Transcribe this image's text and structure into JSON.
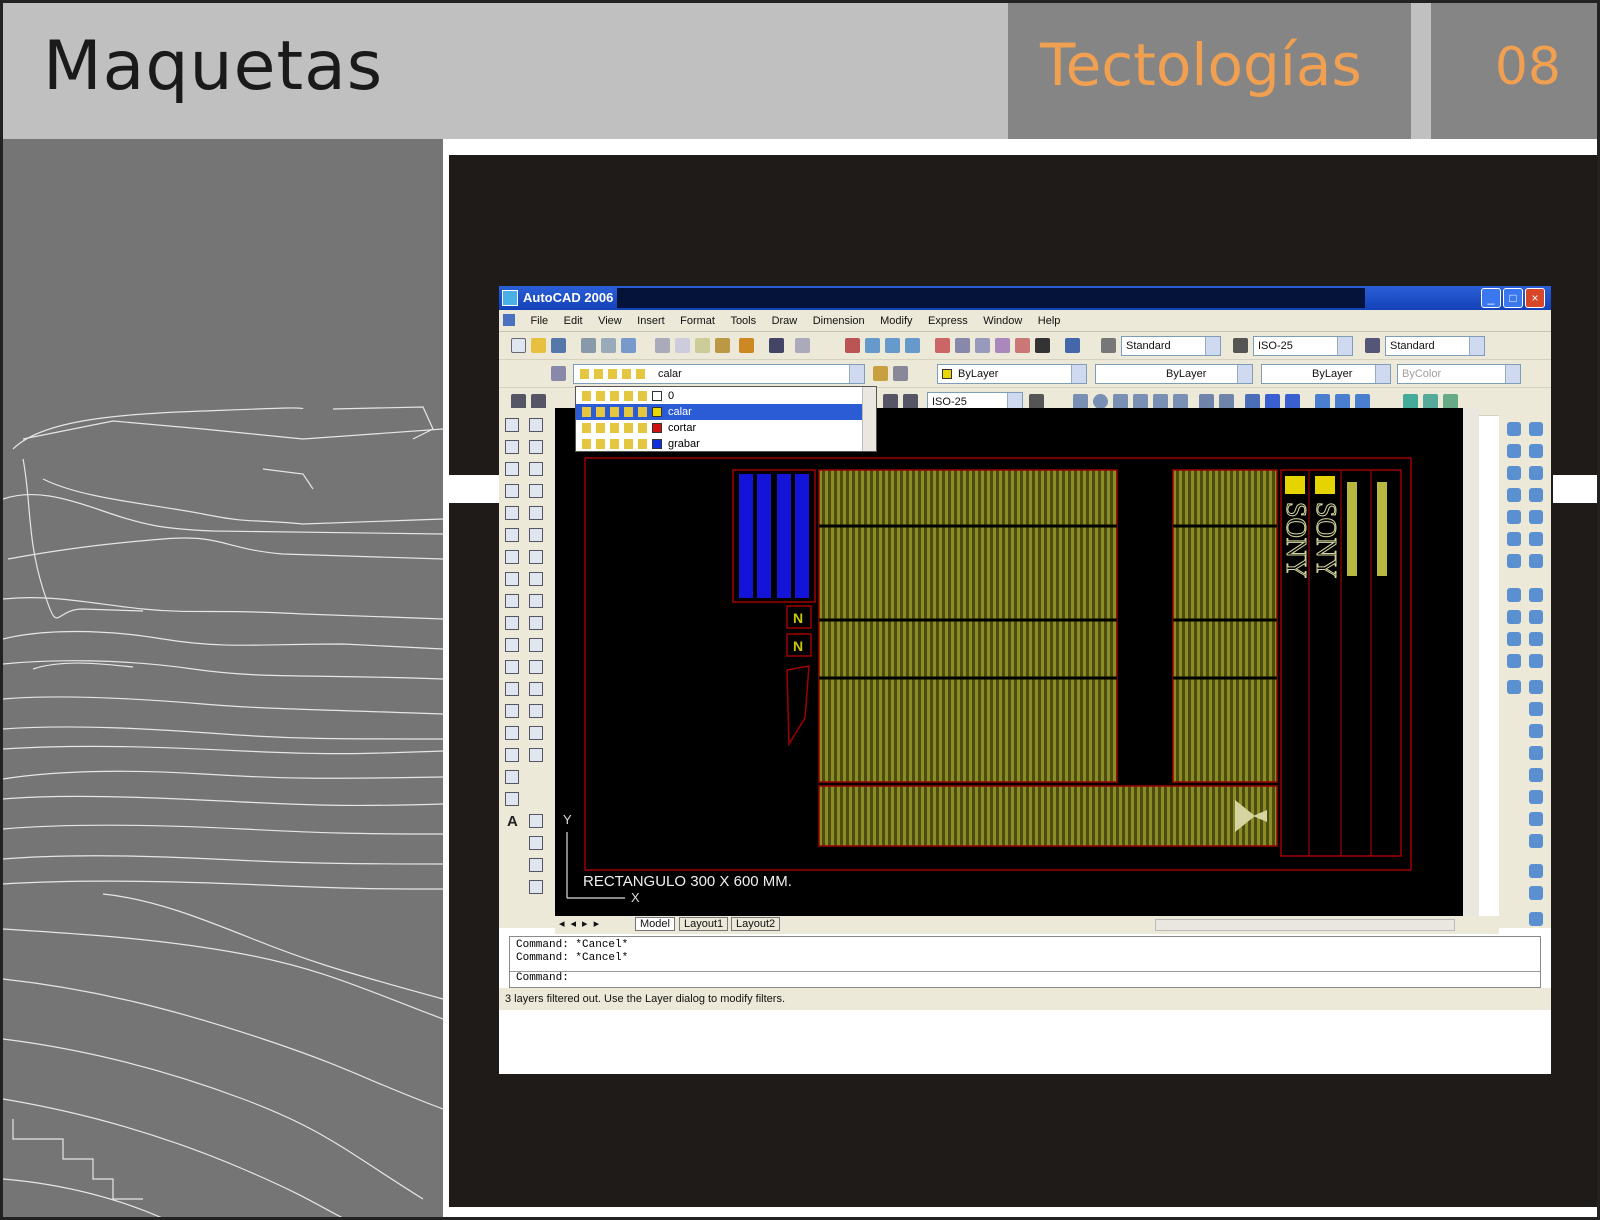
{
  "header": {
    "title": "Maquetas",
    "subtitle": "Tectologías",
    "page_number": "08"
  },
  "colors": {
    "header_light": "#c0c0c0",
    "header_dark": "#858585",
    "accent_orange": "#f0a050",
    "sidebar": "#757575",
    "photo_bg": "#1e1b19",
    "yellow_hatch": "#7a7a1e",
    "blue_block": "#1010d0",
    "red_outline": "#b00000"
  },
  "cad": {
    "window_title": "AutoCAD 2006",
    "menus": [
      "File",
      "Edit",
      "View",
      "Insert",
      "Format",
      "Tools",
      "Draw",
      "Dimension",
      "Modify",
      "Express",
      "Window",
      "Help"
    ],
    "toolbar": {
      "text_style": "Standard",
      "dim_style": "ISO-25",
      "table_style": "Standard",
      "current_layer": "calar",
      "color": "ByLayer",
      "linetype": "ByLayer",
      "lineweight": "ByLayer",
      "plot_style": "ByColor",
      "dim_style2": "ISO-25"
    },
    "layers": [
      {
        "name": "0",
        "color": "#ffffff"
      },
      {
        "name": "calar",
        "color": "#e8d800"
      },
      {
        "name": "cortar",
        "color": "#d01010"
      },
      {
        "name": "grabar",
        "color": "#1030e0"
      }
    ],
    "selected_layer_index": 1,
    "drawing": {
      "caption": "RECTANGULO 300 X 600 MM.",
      "brand_text": "SONY",
      "block_label": "N",
      "ucs_y": "Y",
      "ucs_x": "X"
    },
    "tabs": [
      "Model",
      "Layout1",
      "Layout2"
    ],
    "active_tab": "Model",
    "command_lines": [
      "Command:  *Cancel*",
      "Command:  *Cancel*",
      "Command:"
    ],
    "status_text": "3 layers filtered out.  Use the Layer dialog to modify filters."
  }
}
